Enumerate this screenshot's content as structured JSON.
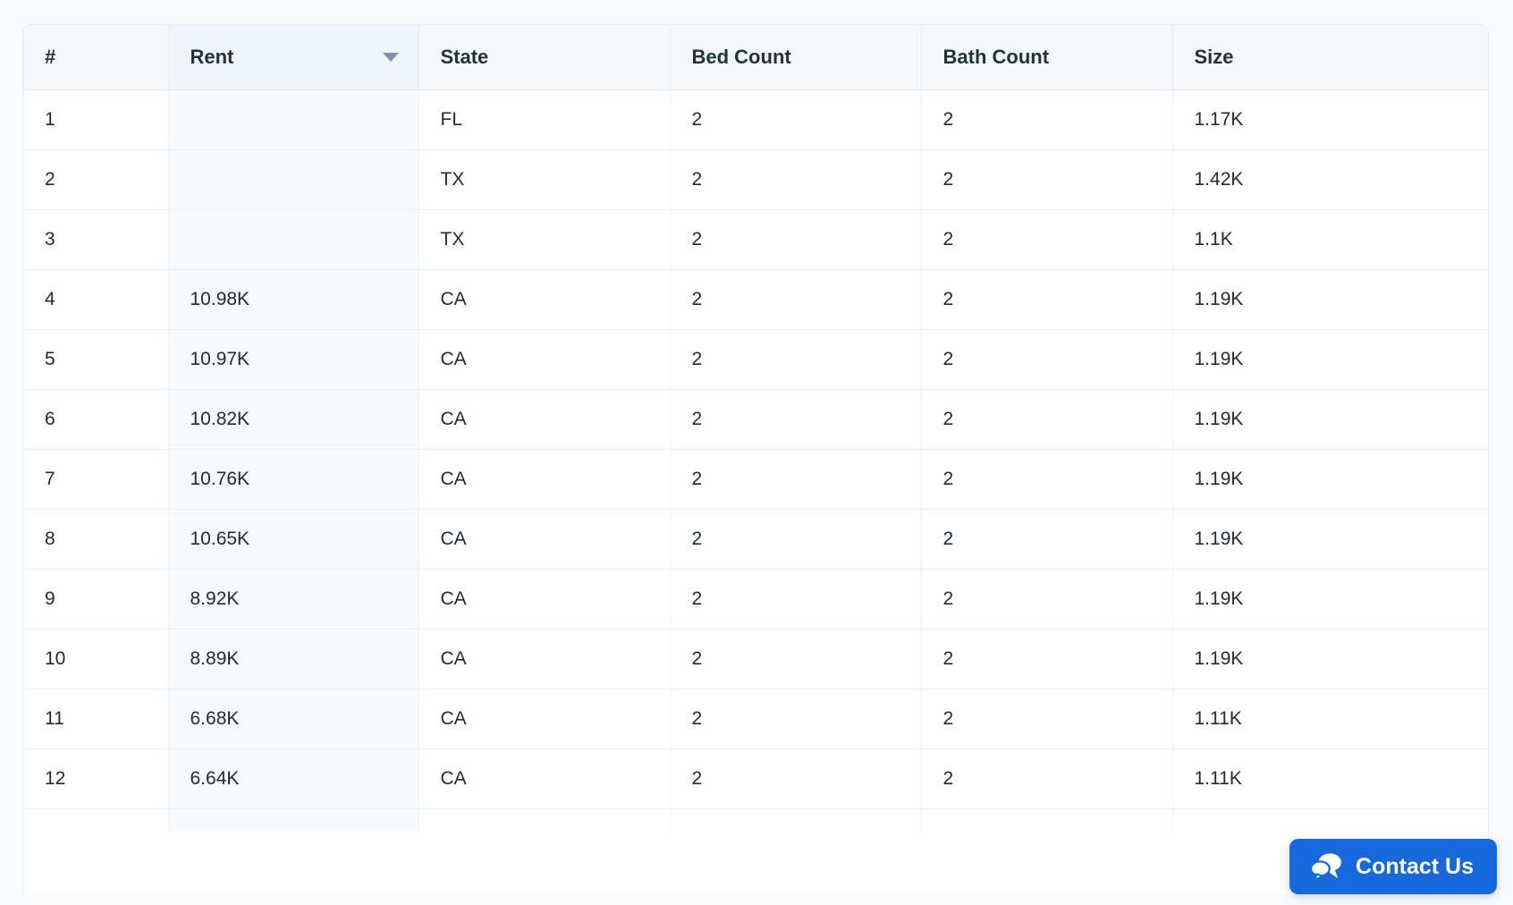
{
  "table": {
    "columns": [
      {
        "key": "num",
        "label": "#",
        "sorted": false,
        "sort_dir": ""
      },
      {
        "key": "rent",
        "label": "Rent",
        "sorted": true,
        "sort_dir": "desc"
      },
      {
        "key": "state",
        "label": "State",
        "sorted": false,
        "sort_dir": ""
      },
      {
        "key": "bed",
        "label": "Bed Count",
        "sorted": false,
        "sort_dir": ""
      },
      {
        "key": "bath",
        "label": "Bath Count",
        "sorted": false,
        "sort_dir": ""
      },
      {
        "key": "size",
        "label": "Size",
        "sorted": false,
        "sort_dir": ""
      }
    ],
    "rows": [
      {
        "num": "1",
        "rent": "",
        "state": "FL",
        "bed": "2",
        "bath": "2",
        "size": "1.17K"
      },
      {
        "num": "2",
        "rent": "",
        "state": "TX",
        "bed": "2",
        "bath": "2",
        "size": "1.42K"
      },
      {
        "num": "3",
        "rent": "",
        "state": "TX",
        "bed": "2",
        "bath": "2",
        "size": "1.1K"
      },
      {
        "num": "4",
        "rent": "10.98K",
        "state": "CA",
        "bed": "2",
        "bath": "2",
        "size": "1.19K"
      },
      {
        "num": "5",
        "rent": "10.97K",
        "state": "CA",
        "bed": "2",
        "bath": "2",
        "size": "1.19K"
      },
      {
        "num": "6",
        "rent": "10.82K",
        "state": "CA",
        "bed": "2",
        "bath": "2",
        "size": "1.19K"
      },
      {
        "num": "7",
        "rent": "10.76K",
        "state": "CA",
        "bed": "2",
        "bath": "2",
        "size": "1.19K"
      },
      {
        "num": "8",
        "rent": "10.65K",
        "state": "CA",
        "bed": "2",
        "bath": "2",
        "size": "1.19K"
      },
      {
        "num": "9",
        "rent": "8.92K",
        "state": "CA",
        "bed": "2",
        "bath": "2",
        "size": "1.19K"
      },
      {
        "num": "10",
        "rent": "8.89K",
        "state": "CA",
        "bed": "2",
        "bath": "2",
        "size": "1.19K"
      },
      {
        "num": "11",
        "rent": "6.68K",
        "state": "CA",
        "bed": "2",
        "bath": "2",
        "size": "1.11K"
      },
      {
        "num": "12",
        "rent": "6.64K",
        "state": "CA",
        "bed": "2",
        "bath": "2",
        "size": "1.11K"
      }
    ]
  },
  "contact_widget": {
    "label": "Contact Us",
    "icon": "chat-bubbles-icon",
    "color": "#1668dc"
  },
  "colors": {
    "header_bg": "#f4f8fb",
    "sorted_col_bg": "#f6fafd",
    "border": "#e7f0f9",
    "text": "#212b36",
    "accent": "#1668dc",
    "page_bg": "#fafbfc"
  }
}
